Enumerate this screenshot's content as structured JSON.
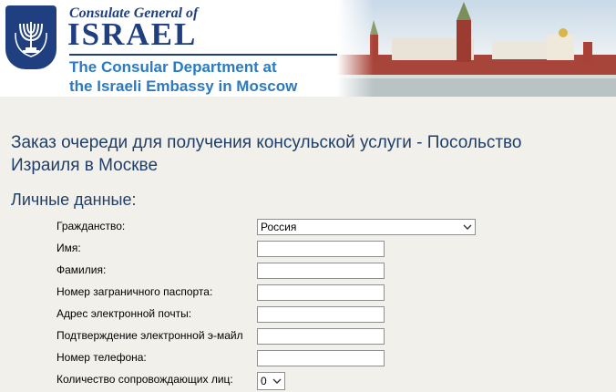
{
  "header": {
    "consulate_line": "Consulate General of",
    "israel_word": "ISRAEL",
    "department_line_1": "The Consular Department at",
    "department_line_2": "the Israeli Embassy in Moscow",
    "emblem_icon": "menorah-emblem-icon",
    "brand_color": "#1f3f80",
    "accent_color": "#2b7ac2"
  },
  "page": {
    "heading": "Заказ очереди для получения консульской услуги - Посольство Израиля в Москве",
    "section_title": "Личные данные:"
  },
  "form": {
    "citizenship_label": "Гражданство:",
    "citizenship_value": "Россия",
    "first_name_label": "Имя:",
    "last_name_label": "Фамилия:",
    "passport_label": "Номер заграничного паспорта:",
    "email_label": "Адрес электронной почты:",
    "email_confirm_label": "Подтверждение электронной э-майл",
    "phone_label": "Номер телефона:",
    "companions_label": "Количество сопровождающих лиц:",
    "companions_value": "0",
    "first_name_value": "",
    "last_name_value": "",
    "passport_value": "",
    "email_value": "",
    "email_confirm_value": "",
    "phone_value": ""
  }
}
